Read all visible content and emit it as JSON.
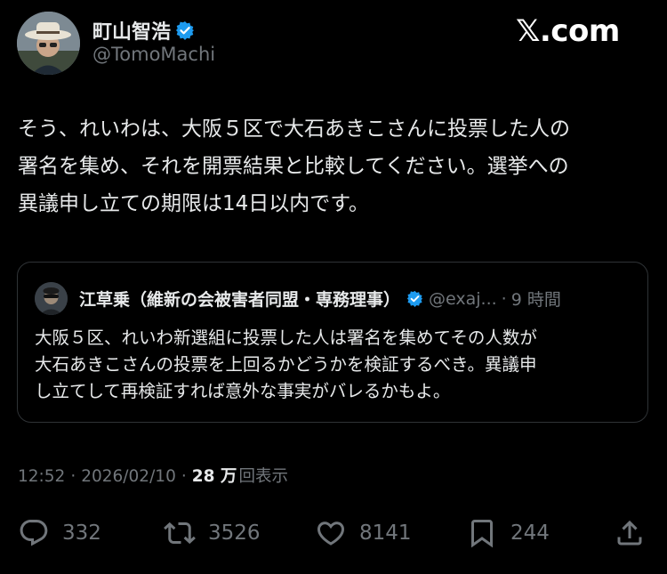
{
  "post": {
    "author": {
      "name": "町山智浩",
      "handle": "@TomoMachi",
      "verified": true,
      "avatar_icon": "profile-photo"
    },
    "site_logo": "𝕏.com",
    "text": "そう、れいわは、大阪５区で大石あきこさんに投票した人の\n署名を集め、それを開票結果と比較してください。選挙への\n異議申し立ての期限は14日以内です。",
    "quoted": {
      "author_name": "江草乗（維新の会被害者同盟・専務理事）",
      "handle": "@exaj...",
      "separator": "·",
      "time": "9 時間",
      "verified": true,
      "text": "大阪５区、れいわ新選組に投票した人は署名を集めてその人数が\n大石あきこさんの投票を上回るかどうかを検証するべき。異議申\nし立てして再検証すれば意外な事実がバレるかもよ。"
    },
    "meta": {
      "time": "12:52",
      "separator": "·",
      "date": "2026/02/10",
      "views_count": "28 万",
      "views_label": "回表示"
    },
    "actions": {
      "reply": {
        "icon": "reply-icon",
        "count": "332"
      },
      "repost": {
        "icon": "repost-icon",
        "count": "3526"
      },
      "like": {
        "icon": "heart-icon",
        "count": "8141"
      },
      "bookmark": {
        "icon": "bookmark-icon",
        "count": "244"
      },
      "share": {
        "icon": "share-icon"
      }
    }
  },
  "colors": {
    "background": "#000000",
    "primary_text": "#e7e9ea",
    "secondary_text": "#71767b",
    "verified_badge": "#1d9bf0",
    "border": "#2f3336"
  }
}
